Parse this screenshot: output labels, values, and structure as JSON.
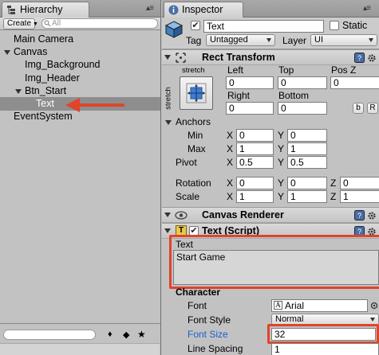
{
  "hierarchy": {
    "tab_label": "Hierarchy",
    "create_label": "Create",
    "search_placeholder": "All",
    "items": [
      {
        "label": "Main Camera"
      },
      {
        "label": "Canvas"
      },
      {
        "label": "Img_Background"
      },
      {
        "label": "Img_Header"
      },
      {
        "label": "Btn_Start"
      },
      {
        "label": "Text"
      },
      {
        "label": "EventSystem"
      }
    ],
    "selected_item": "Text"
  },
  "inspector": {
    "tab_label": "Inspector",
    "object_name": "Text",
    "active_checked": true,
    "static_label": "Static",
    "static_checked": false,
    "tag_label": "Tag",
    "tag_value": "Untagged",
    "layer_label": "Layer",
    "layer_value": "UI",
    "rect_transform": {
      "title": "Rect Transform",
      "anchor_preset_top": "stretch",
      "anchor_preset_side": "stretch",
      "left_label": "Left",
      "left_value": "0",
      "top_label": "Top",
      "top_value": "0",
      "posz_label": "Pos Z",
      "posz_value": "0",
      "right_label": "Right",
      "right_value": "0",
      "bottom_label": "Bottom",
      "bottom_value": "0",
      "blueprint_btn": "b",
      "raw_btn": "R",
      "anchors_label": "Anchors",
      "min_label": "Min",
      "min_x": "0",
      "min_y": "0",
      "max_label": "Max",
      "max_x": "1",
      "max_y": "1",
      "pivot_label": "Pivot",
      "pivot_x": "0.5",
      "pivot_y": "0.5",
      "rotation_label": "Rotation",
      "rot_x": "0",
      "rot_y": "0",
      "rot_z": "0",
      "scale_label": "Scale",
      "scale_x": "1",
      "scale_y": "1",
      "scale_z": "1",
      "x": "X",
      "y": "Y",
      "z": "Z"
    },
    "canvas_renderer": {
      "title": "Canvas Renderer"
    },
    "text_script": {
      "title": "Text (Script)",
      "enabled": true,
      "text_label": "Text",
      "text_value": "Start Game",
      "character_label": "Character",
      "font_label": "Font",
      "font_value": "Arial",
      "font_style_label": "Font Style",
      "font_style_value": "Normal",
      "font_size_label": "Font Size",
      "font_size_value": "32",
      "line_spacing_label": "Line Spacing",
      "line_spacing_value": "1"
    }
  },
  "colors": {
    "annotation_red": "#e0442a",
    "selection_gray": "#8e8e8e",
    "font_size_label_blue": "#1a5fd1"
  }
}
